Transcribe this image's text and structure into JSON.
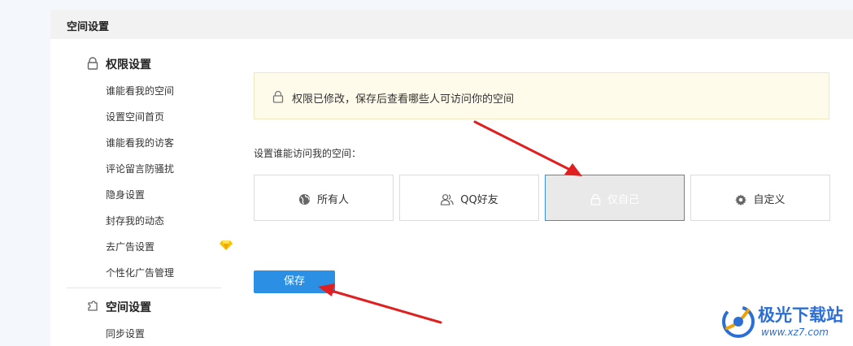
{
  "header": {
    "title": "空间设置"
  },
  "sidebar": {
    "sections": [
      {
        "title": "权限设置",
        "icon": "lock-icon",
        "items": [
          {
            "label": "谁能看我的空间"
          },
          {
            "label": "设置空间首页"
          },
          {
            "label": "谁能看我的访客"
          },
          {
            "label": "评论留言防骚扰"
          },
          {
            "label": "隐身设置"
          },
          {
            "label": "封存我的动态"
          },
          {
            "label": "去广告设置",
            "badge_icon": "yellow-diamond-icon"
          },
          {
            "label": "个性化广告管理"
          }
        ]
      },
      {
        "title": "空间设置",
        "icon": "puzzle-settings-icon",
        "items": [
          {
            "label": "同步设置"
          }
        ]
      }
    ]
  },
  "main": {
    "notice": {
      "text": "权限已修改，保存后查看哪些人可访问你的空间",
      "icon": "lock-icon"
    },
    "question_label": "设置谁能访问我的空间：",
    "options": [
      {
        "label": "所有人",
        "icon": "globe-icon",
        "selected": false
      },
      {
        "label": "QQ好友",
        "icon": "friends-icon",
        "selected": false
      },
      {
        "label": "仅自己",
        "icon": "lock-icon",
        "selected": true
      },
      {
        "label": "自定义",
        "icon": "gear-icon",
        "selected": false
      }
    ],
    "save_label": "保存"
  },
  "watermark": {
    "brand": "极光下载站",
    "url": "www.xz7.com"
  },
  "colors": {
    "accent": "#2b8fe3",
    "notice_bg": "#fffbea",
    "selected_border": "#3a8fd8",
    "annotation_arrow": "#e02020"
  }
}
